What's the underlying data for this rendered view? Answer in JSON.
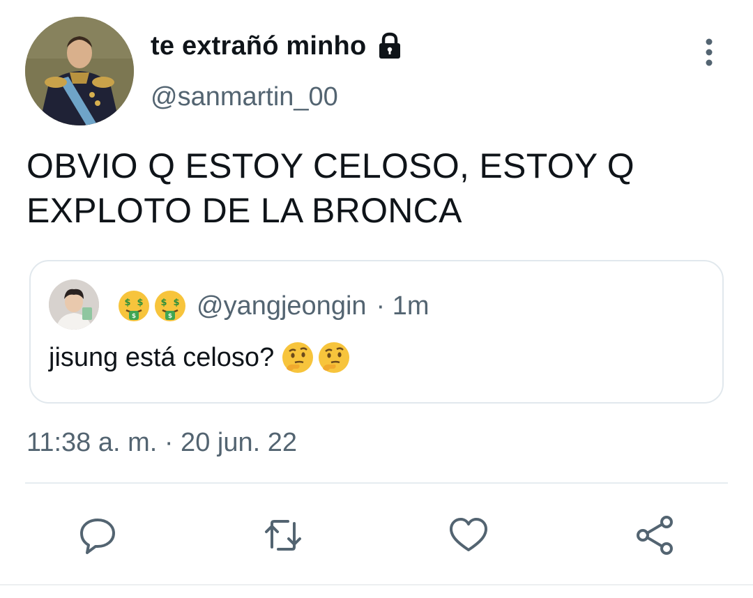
{
  "author": {
    "display_name": "te extrañó minho",
    "handle": "@sanmartin_00",
    "protected": true
  },
  "tweet": {
    "text": "OBVIO Q ESTOY CELOSO, ESTOY Q EXPLOTO DE LA BRONCA"
  },
  "quoted": {
    "header_emojis": [
      "money-mouth-face",
      "money-mouth-face"
    ],
    "handle": "@yangjeongin",
    "time": "· 1m",
    "text": "jisung está celoso?",
    "text_emojis": [
      "thinking-face",
      "thinking-face"
    ]
  },
  "timestamp": "11:38 a. m. · 20 jun. 22",
  "actions": [
    "reply-icon",
    "retweet-icon",
    "like-icon",
    "share-icon"
  ],
  "colors": {
    "text_primary": "#0f1419",
    "text_secondary": "#536471",
    "border": "#e1e8ed"
  }
}
